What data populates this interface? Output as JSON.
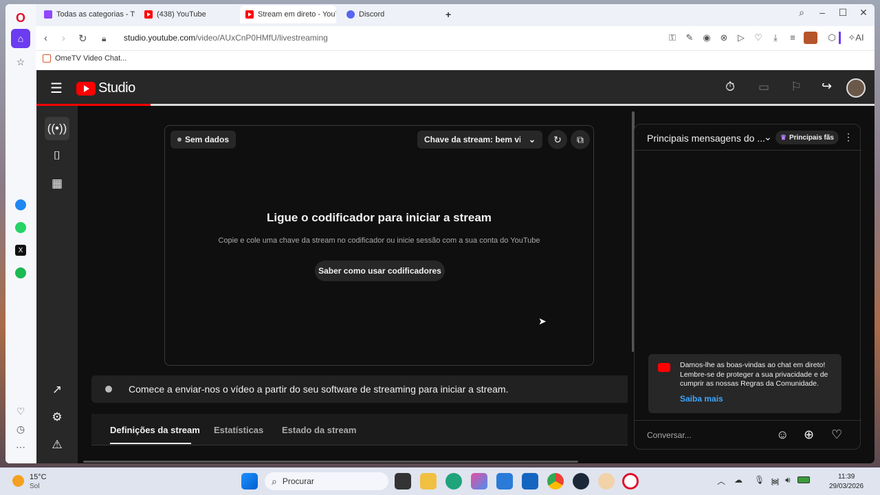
{
  "browser": {
    "tabs": [
      {
        "label": "Todas as categorias - Twitc",
        "icon": "twitch-icon"
      },
      {
        "label": "(438) YouTube",
        "icon": "youtube-icon"
      },
      {
        "label": "Stream em direto - YouTu",
        "icon": "youtube-icon"
      },
      {
        "label": "Discord",
        "icon": "discord-icon"
      }
    ],
    "new_tab": "+",
    "url_domain": "studio.youtube.com",
    "url_path": "/video/AUxCnP0HMfU/livestreaming",
    "bookmark": "OmeTV Video Chat...",
    "ai_label": "AI"
  },
  "studio": {
    "logo_text": "Studio",
    "status_chip": "Sem dados",
    "stream_key_label": "Chave da stream: bem vindo",
    "preview_title": "Ligue o codificador para iniciar a stream",
    "preview_subtitle": "Copie e cole uma chave da stream no codificador ou inicie sessão com a sua conta do YouTube",
    "encoder_button": "Saber como usar codificadores",
    "banner_text": "Comece a enviar-nos o vídeo a partir do seu software de streaming para iniciar a stream.",
    "tabs": [
      "Definições da stream",
      "Estatísticas",
      "Estado da stream"
    ]
  },
  "chat": {
    "title": "Principais mensagens do ...",
    "badge": "Principais fãs",
    "welcome": "Damos-lhe as boas-vindas ao chat em direto! Lembre-se de proteger a sua privacidade e de cumprir as nossas Regras da Comunidade.",
    "learn_more": "Saiba mais",
    "input_placeholder": "Conversar..."
  },
  "taskbar": {
    "weather_temp": "15°C",
    "weather_desc": "Sol",
    "search_placeholder": "Procurar",
    "time": "11:39",
    "date": "29/03/2026"
  },
  "colors": {
    "accent": "#ff0000",
    "link": "#3ea6ff"
  }
}
